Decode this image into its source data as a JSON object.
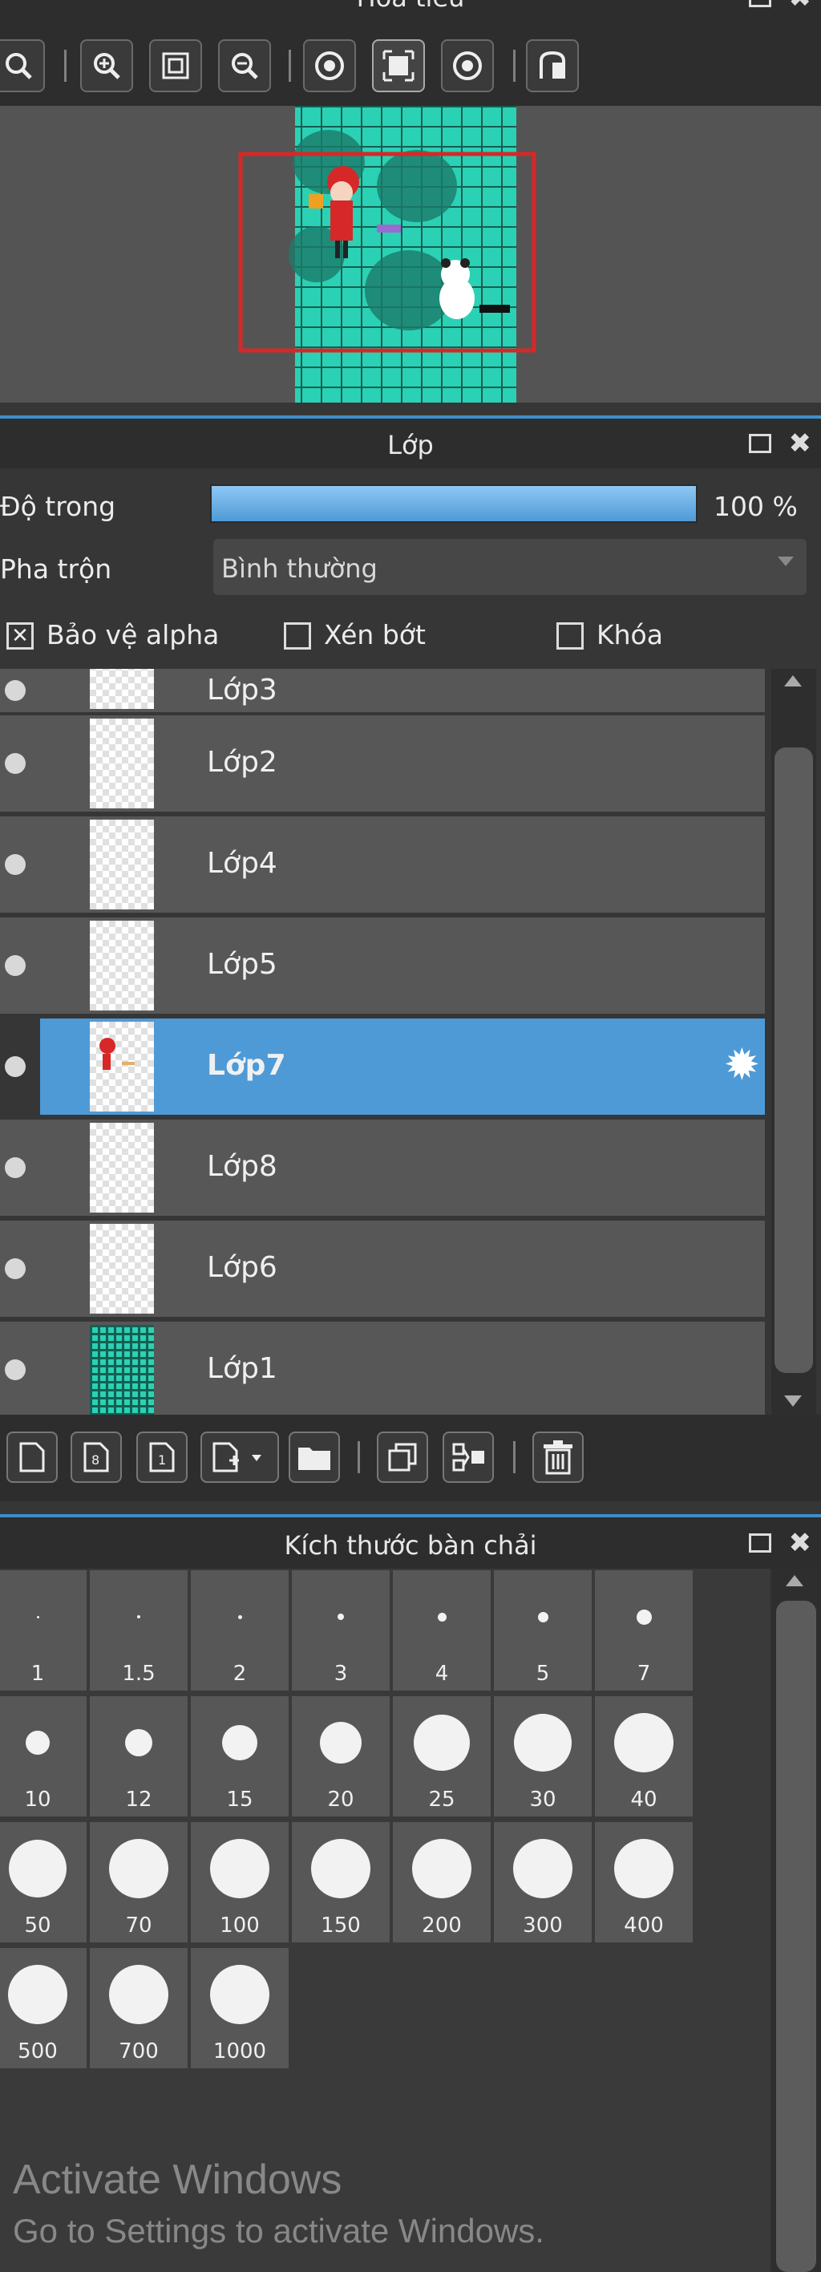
{
  "navigator": {
    "title": "Hoa tieu",
    "tools": [
      "zoom-fit-icon",
      "zoom-in-icon",
      "fit-screen-icon",
      "zoom-out-icon",
      "rotate-left-icon",
      "actual-size-icon",
      "rotate-right-icon",
      "flip-icon"
    ]
  },
  "layers_panel": {
    "title": "Lớp",
    "opacity_label": "Độ trong",
    "opacity_value": "100 %",
    "opacity_fraction": 1.0,
    "blend_label": "Pha trộn",
    "blend_value": "Bình thường",
    "protect_alpha": {
      "label": "Bảo vệ alpha",
      "checked": true
    },
    "clipping": {
      "label": "Xén bớt",
      "checked": false
    },
    "lock": {
      "label": "Khóa",
      "checked": false
    },
    "layers": [
      {
        "name": "Lớp3"
      },
      {
        "name": "Lớp2"
      },
      {
        "name": "Lớp4"
      },
      {
        "name": "Lớp5"
      },
      {
        "name": "Lớp7",
        "selected": true
      },
      {
        "name": "Lớp8"
      },
      {
        "name": "Lớp6"
      },
      {
        "name": "Lớp1"
      }
    ],
    "bottom_tools": [
      "new-layer-icon",
      "new-8bit-layer-icon",
      "new-1bit-layer-icon",
      "add-layer-menu-icon",
      "folder-icon",
      "duplicate-icon",
      "merge-icon",
      "trash-icon"
    ]
  },
  "brush_panel": {
    "title": "Kích thước bàn chải",
    "sizes": [
      "1",
      "1.5",
      "2",
      "3",
      "4",
      "5",
      "7",
      "10",
      "12",
      "15",
      "20",
      "25",
      "30",
      "40",
      "50",
      "70",
      "100",
      "150",
      "200",
      "300",
      "400",
      "500",
      "700",
      "1000"
    ]
  },
  "watermark": {
    "title": "Activate Windows",
    "subtitle": "Go to Settings to activate Windows."
  },
  "colors": {
    "accent": "#4e9ad6",
    "panel": "#363636",
    "row": "#575757",
    "nav_red": "#d62828",
    "canvas_teal": "#2bd1b4"
  }
}
